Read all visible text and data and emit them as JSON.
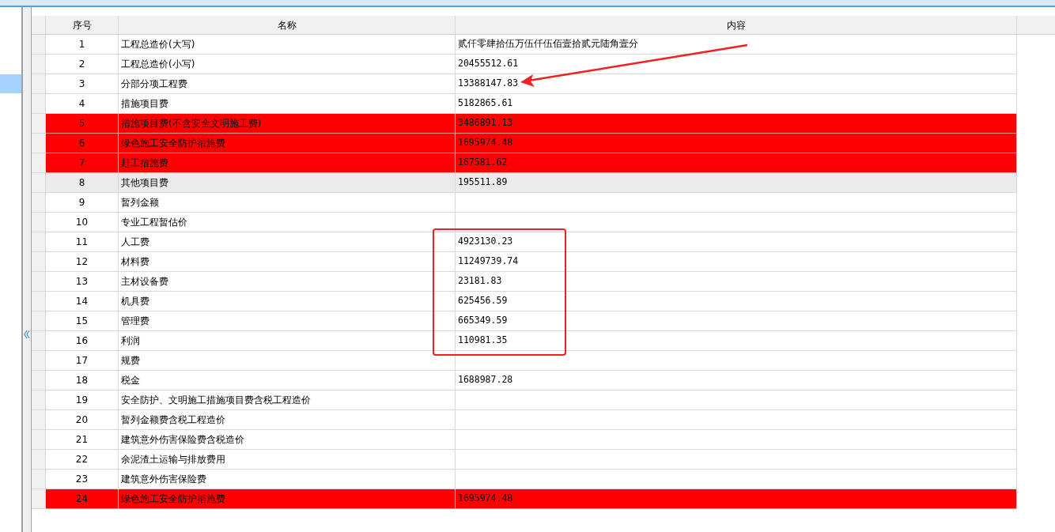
{
  "table": {
    "columns": [
      "序号",
      "名称",
      "内容"
    ],
    "rows": [
      {
        "no": "1",
        "name": "工程总造价(大写)",
        "value": "贰仟零肆拾伍万伍仟伍佰壹拾贰元陆角壹分",
        "flagged": false,
        "selected": false
      },
      {
        "no": "2",
        "name": "工程总造价(小写)",
        "value": "20455512.61",
        "flagged": false,
        "selected": false
      },
      {
        "no": "3",
        "name": "分部分项工程费",
        "value": "13388147.83",
        "flagged": false,
        "selected": false
      },
      {
        "no": "4",
        "name": "措施项目费",
        "value": "5182865.61",
        "flagged": false,
        "selected": false
      },
      {
        "no": "5",
        "name": "措施项目费(不含安全文明施工费)",
        "value": "3486891.13",
        "flagged": true,
        "selected": false
      },
      {
        "no": "6",
        "name": "绿色施工安全防护措施费",
        "value": "1695974.48",
        "flagged": true,
        "selected": false
      },
      {
        "no": "7",
        "name": "赶工措施费",
        "value": "167581.62",
        "flagged": true,
        "selected": false
      },
      {
        "no": "8",
        "name": "其他项目费",
        "value": "195511.89",
        "flagged": false,
        "selected": true
      },
      {
        "no": "9",
        "name": "暂列金额",
        "flagged": false,
        "selected": false
      },
      {
        "no": "10",
        "name": "专业工程暂估价",
        "flagged": false,
        "selected": false
      },
      {
        "no": "11",
        "name": "人工费",
        "value": "4923130.23",
        "flagged": false,
        "selected": false
      },
      {
        "no": "12",
        "name": "材料费",
        "value": "11249739.74",
        "flagged": false,
        "selected": false
      },
      {
        "no": "13",
        "name": "主材设备费",
        "value": "23181.83",
        "flagged": false,
        "selected": false
      },
      {
        "no": "14",
        "name": "机具费",
        "value": "625456.59",
        "flagged": false,
        "selected": false
      },
      {
        "no": "15",
        "name": "管理费",
        "value": "665349.59",
        "flagged": false,
        "selected": false
      },
      {
        "no": "16",
        "name": "利润",
        "value": "110981.35",
        "flagged": false,
        "selected": false
      },
      {
        "no": "17",
        "name": "规费",
        "flagged": false,
        "selected": false
      },
      {
        "no": "18",
        "name": "税金",
        "value": "1688987.28",
        "flagged": false,
        "selected": false
      },
      {
        "no": "19",
        "name": "安全防护、文明施工措施项目费含税工程造价",
        "flagged": false,
        "selected": false
      },
      {
        "no": "20",
        "name": "暂列金额费含税工程造价",
        "flagged": false,
        "selected": false
      },
      {
        "no": "21",
        "name": "建筑意外伤害保险费含税造价",
        "flagged": false,
        "selected": false
      },
      {
        "no": "22",
        "name": "余泥渣土运输与排放费用",
        "flagged": false,
        "selected": false
      },
      {
        "no": "23",
        "name": "建筑意外伤害保险费",
        "flagged": false,
        "selected": false
      },
      {
        "no": "24",
        "name": "绿色施工安全防护措施费",
        "value": "1695974.48",
        "flagged": true,
        "selected": false
      }
    ]
  }
}
